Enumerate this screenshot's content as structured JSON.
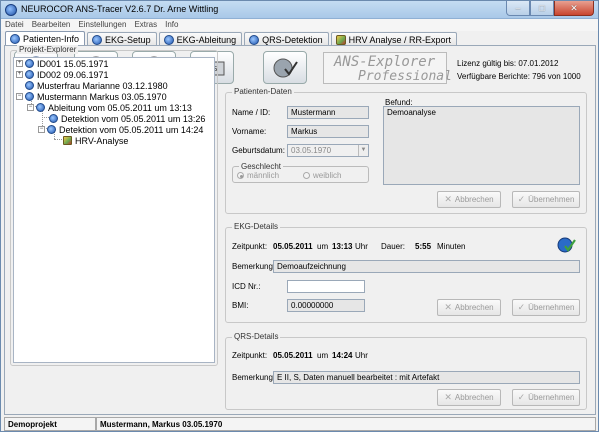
{
  "window": {
    "title": "NEUROCOR ANS-Tracer V2.6.7 Dr. Arne Wittling",
    "buttons": {
      "minimize": "–",
      "maximize": "□",
      "close": "✕"
    }
  },
  "menu": [
    "Datei",
    "Bearbeiten",
    "Einstellungen",
    "Extras",
    "Info"
  ],
  "tabs": [
    {
      "label": "Patienten-Info",
      "icon": "ans-globe-icon"
    },
    {
      "label": "EKG-Setup",
      "icon": "ans-globe-icon"
    },
    {
      "label": "EKG-Ableitung",
      "icon": "ans-globe-icon"
    },
    {
      "label": "QRS-Detektion",
      "icon": "ans-globe-icon"
    },
    {
      "label": "HRV Analyse / RR-Export",
      "icon": "hrv-leaf-icon"
    }
  ],
  "toolbar": {
    "logo_line1": "ANS-Explorer",
    "logo_line2": "Professional",
    "license_label": "Lizenz gültig bis:",
    "license_value": "07.01.2012",
    "reports_label": "Verfügbare Berichte:",
    "reports_value": "796 von 1000"
  },
  "explorer": {
    "title": "Projekt-Explorer",
    "nodes": [
      {
        "text": "ID001  15.05.1971",
        "icon": "patient-globe-icon",
        "expander": "+"
      },
      {
        "text": "ID002  09.06.1971",
        "icon": "patient-globe-icon",
        "expander": "+"
      },
      {
        "text": "Musterfrau Marianne 03.12.1980",
        "icon": "patient-globe-icon",
        "expander": ""
      },
      {
        "text": "Mustermann Markus 03.05.1970",
        "icon": "patient-globe-icon",
        "expander": "−"
      },
      {
        "text": "Ableitung vom 05.05.2011 um 13:13",
        "icon": "ecg-recording-icon",
        "expander": "−"
      },
      {
        "text": "Detektion vom 05.05.2011 um 13:26",
        "icon": "detection-icon",
        "expander": ""
      },
      {
        "text": "Detektion vom 05.05.2011 um 14:24",
        "icon": "detection-icon",
        "expander": "−"
      },
      {
        "text": "HRV-Analyse",
        "icon": "hrv-leaf-icon",
        "expander": ""
      }
    ]
  },
  "patient": {
    "title": "Patienten-Daten",
    "name_label": "Name / ID:",
    "name_value": "Mustermann",
    "firstname_label": "Vorname:",
    "firstname_value": "Markus",
    "birth_label": "Geburtsdatum:",
    "birth_value": "03.05.1970",
    "gender_title": "Geschlecht",
    "gender_male": "männlich",
    "gender_female": "weiblich",
    "finding_label": "Befund:",
    "finding_value": "Demoanalyse",
    "cancel": "Abbrechen",
    "apply": "Übernehmen"
  },
  "ekg": {
    "title": "EKG-Details",
    "time_label": "Zeitpunkt:",
    "date": "05.05.2011",
    "um": "um",
    "time": "13:13",
    "uhr": "Uhr",
    "duration_label": "Dauer:",
    "duration": "5:55",
    "duration_unit": "Minuten",
    "remark_label": "Bemerkung:",
    "remark_value": "Demoaufzeichnung",
    "icd_label": "ICD Nr.:",
    "icd_value": "",
    "bmi_label": "BMI:",
    "bmi_value": "0.00000000",
    "cancel": "Abbrechen",
    "apply": "Übernehmen"
  },
  "qrs": {
    "title": "QRS-Details",
    "time_label": "Zeitpunkt:",
    "date": "05.05.2011",
    "um": "um",
    "time": "14:24",
    "uhr": "Uhr",
    "remark_label": "Bemerkung:",
    "remark_value": "E II, S, Daten manuell bearbeitet : mit Artefakt",
    "cancel": "Abbrechen",
    "apply": "Übernehmen"
  },
  "status": {
    "project": "Demoprojekt",
    "patient": "Mustermann, Markus 03.05.1970"
  }
}
